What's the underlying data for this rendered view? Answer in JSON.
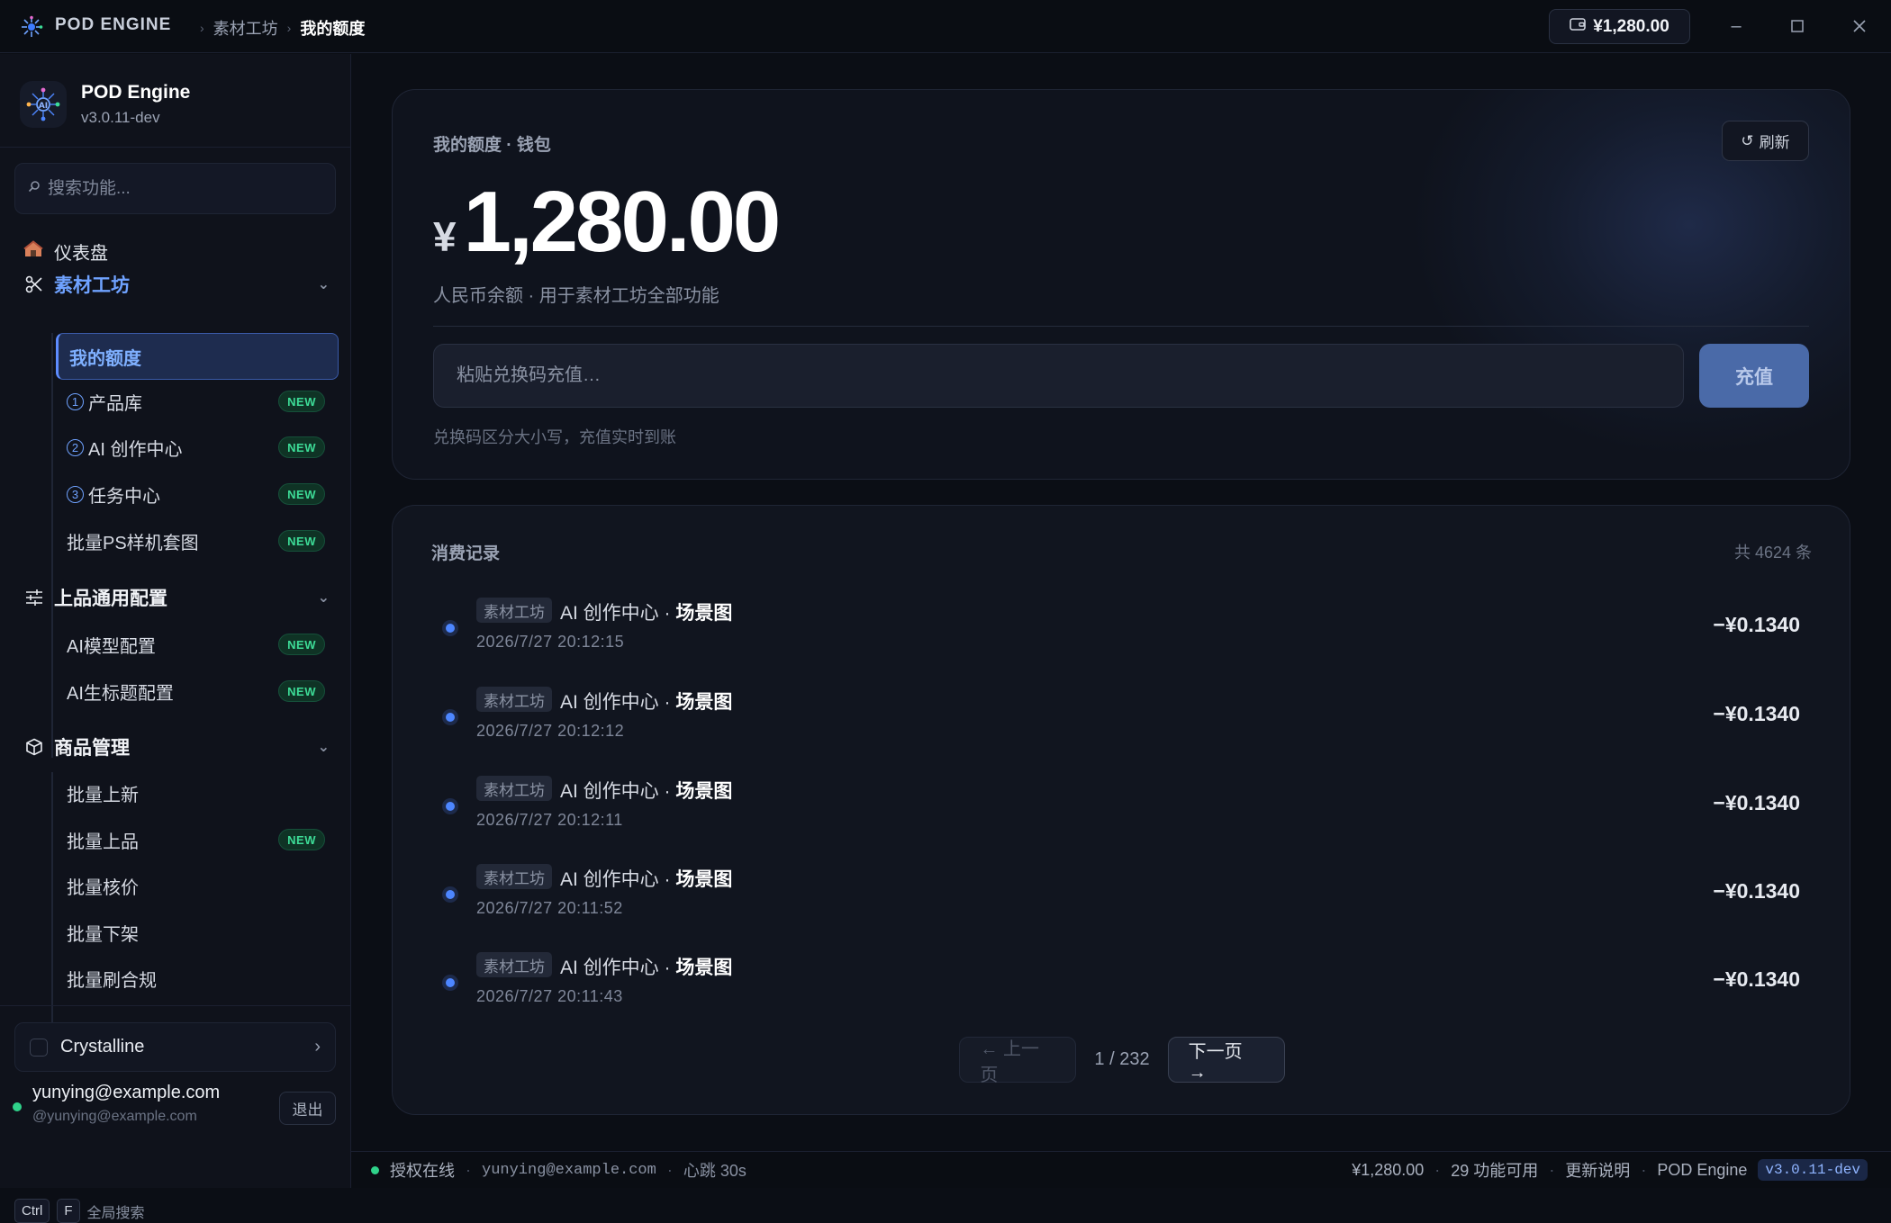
{
  "titlebar": {
    "app_name": "POD ENGINE",
    "crumbs": [
      "素材工坊",
      "我的额度"
    ],
    "balance": "¥1,280.00"
  },
  "sidebar": {
    "brand_name": "POD Engine",
    "brand_version": "v3.0.11-dev",
    "search_placeholder": "搜索功能...",
    "dashboard": "仪表盘",
    "groups": [
      {
        "label": "素材工坊",
        "items": [
          {
            "label": "我的额度",
            "badge": ""
          },
          {
            "num": "1",
            "label": "产品库",
            "badge": "NEW"
          },
          {
            "num": "2",
            "label": "AI 创作中心",
            "badge": "NEW"
          },
          {
            "num": "3",
            "label": "任务中心",
            "badge": "NEW"
          },
          {
            "label": "批量PS样机套图",
            "badge": "NEW"
          }
        ]
      },
      {
        "label": "上品通用配置",
        "items": [
          {
            "label": "AI模型配置",
            "badge": "NEW"
          },
          {
            "label": "AI生标题配置",
            "badge": "NEW"
          }
        ]
      },
      {
        "label": "商品管理",
        "items": [
          {
            "label": "批量上新",
            "badge": ""
          },
          {
            "label": "批量上品",
            "badge": "NEW"
          },
          {
            "label": "批量核价",
            "badge": ""
          },
          {
            "label": "批量下架",
            "badge": ""
          },
          {
            "label": "批量刷合规",
            "badge": ""
          }
        ]
      }
    ],
    "workspace": "Crystalline",
    "user_email": "yunying@example.com",
    "user_handle": "@yunying@example.com",
    "logout": "退出",
    "kbd1": "Ctrl",
    "kbd2": "F",
    "kbd_hint": "全局搜索"
  },
  "wallet": {
    "label": "我的额度 · 钱包",
    "refresh": "刷新",
    "currency": "¥",
    "amount": "1,280.00",
    "subtitle": "人民币余额 · 用于素材工坊全部功能",
    "redeem_placeholder": "粘贴兑换码充值…",
    "topup": "充值",
    "hint": "兑换码区分大小写，充值实时到账"
  },
  "records": {
    "title": "消费记录",
    "count": "共 4624 条",
    "rows": [
      {
        "tag": "素材工坊",
        "module": "AI 创作中心 · ",
        "item": "场景图",
        "time": "2026/7/27 20:12:15",
        "amount": "−¥0.1340"
      },
      {
        "tag": "素材工坊",
        "module": "AI 创作中心 · ",
        "item": "场景图",
        "time": "2026/7/27 20:12:12",
        "amount": "−¥0.1340"
      },
      {
        "tag": "素材工坊",
        "module": "AI 创作中心 · ",
        "item": "场景图",
        "time": "2026/7/27 20:12:11",
        "amount": "−¥0.1340"
      },
      {
        "tag": "素材工坊",
        "module": "AI 创作中心 · ",
        "item": "场景图",
        "time": "2026/7/27 20:11:52",
        "amount": "−¥0.1340"
      },
      {
        "tag": "素材工坊",
        "module": "AI 创作中心 · ",
        "item": "场景图",
        "time": "2026/7/27 20:11:43",
        "amount": "−¥0.1340"
      }
    ],
    "prev": "← 上一页",
    "page": "1 / 232",
    "next": "下一页 →"
  },
  "statusbar": {
    "license": "授权在线",
    "user": "yunying@example.com",
    "heartbeat": "心跳 30s",
    "balance": "¥1,280.00",
    "features": "29 功能可用",
    "changelog": "更新说明",
    "app": "POD Engine",
    "version": "v3.0.11-dev"
  },
  "colors": {
    "accent": "#5d8cff",
    "new_badge": "#3ddc97",
    "online": "#2fd28a",
    "topup_button": "#4a6aa8"
  }
}
